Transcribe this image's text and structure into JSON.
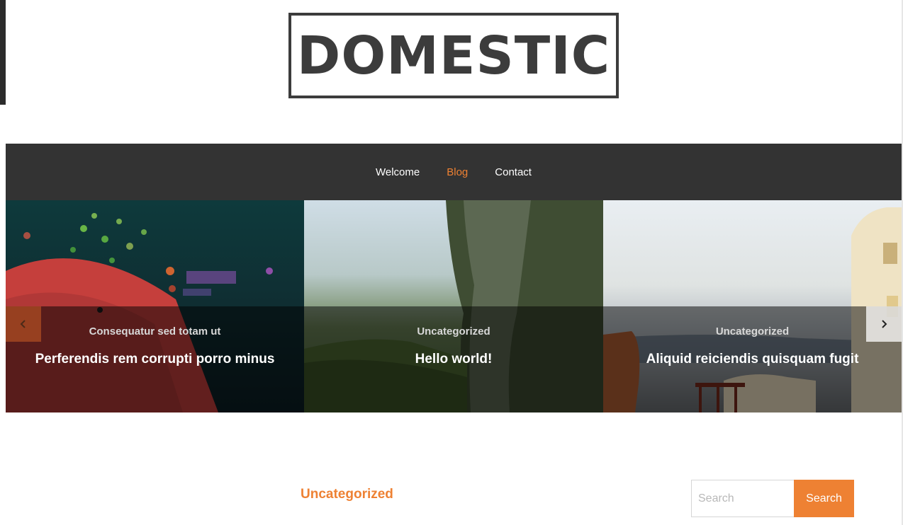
{
  "site": {
    "logo_text": "DOMESTIC"
  },
  "nav": {
    "items": [
      {
        "label": "Welcome",
        "active": false
      },
      {
        "label": "Blog",
        "active": true
      },
      {
        "label": "Contact",
        "active": false
      }
    ]
  },
  "slider": {
    "slides": [
      {
        "category": "Consequatur sed totam ut",
        "title": "Perferendis rem corrupti porro minus"
      },
      {
        "category": "Uncategorized",
        "title": "Hello world!"
      },
      {
        "category": "Uncategorized",
        "title": "Aliquid reiciendis quisquam fugit"
      }
    ]
  },
  "content": {
    "category": "Uncategorized"
  },
  "search": {
    "placeholder": "Search",
    "button_label": "Search"
  },
  "colors": {
    "accent": "#ee8133",
    "nav_bg": "#333333",
    "logo": "#3c3c3c"
  },
  "icons": {
    "prev": "chevron-left-icon",
    "next": "chevron-right-icon"
  }
}
